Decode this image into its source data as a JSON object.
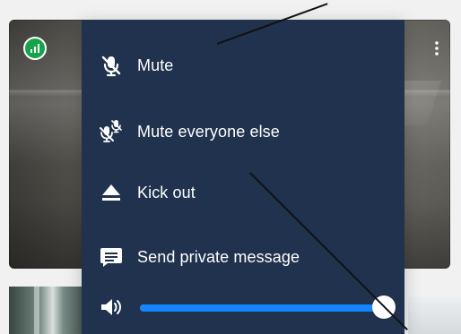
{
  "menu": {
    "items": [
      {
        "label": "Mute",
        "icon": "mic-off-icon"
      },
      {
        "label": "Mute everyone else",
        "icon": "mute-everyone-icon"
      },
      {
        "label": "Kick out",
        "icon": "eject-icon"
      },
      {
        "label": "Send private message",
        "icon": "chat-icon"
      }
    ]
  },
  "volume": {
    "level": 1.0
  },
  "status": {
    "signal_icon": "signal-strength-icon",
    "more_icon": "more-vertical-icon"
  },
  "colors": {
    "menu_bg": "#20324d",
    "slider_fill": "#1585ff",
    "slider_track": "#6a7f9e",
    "signal_green": "#16a34a"
  }
}
